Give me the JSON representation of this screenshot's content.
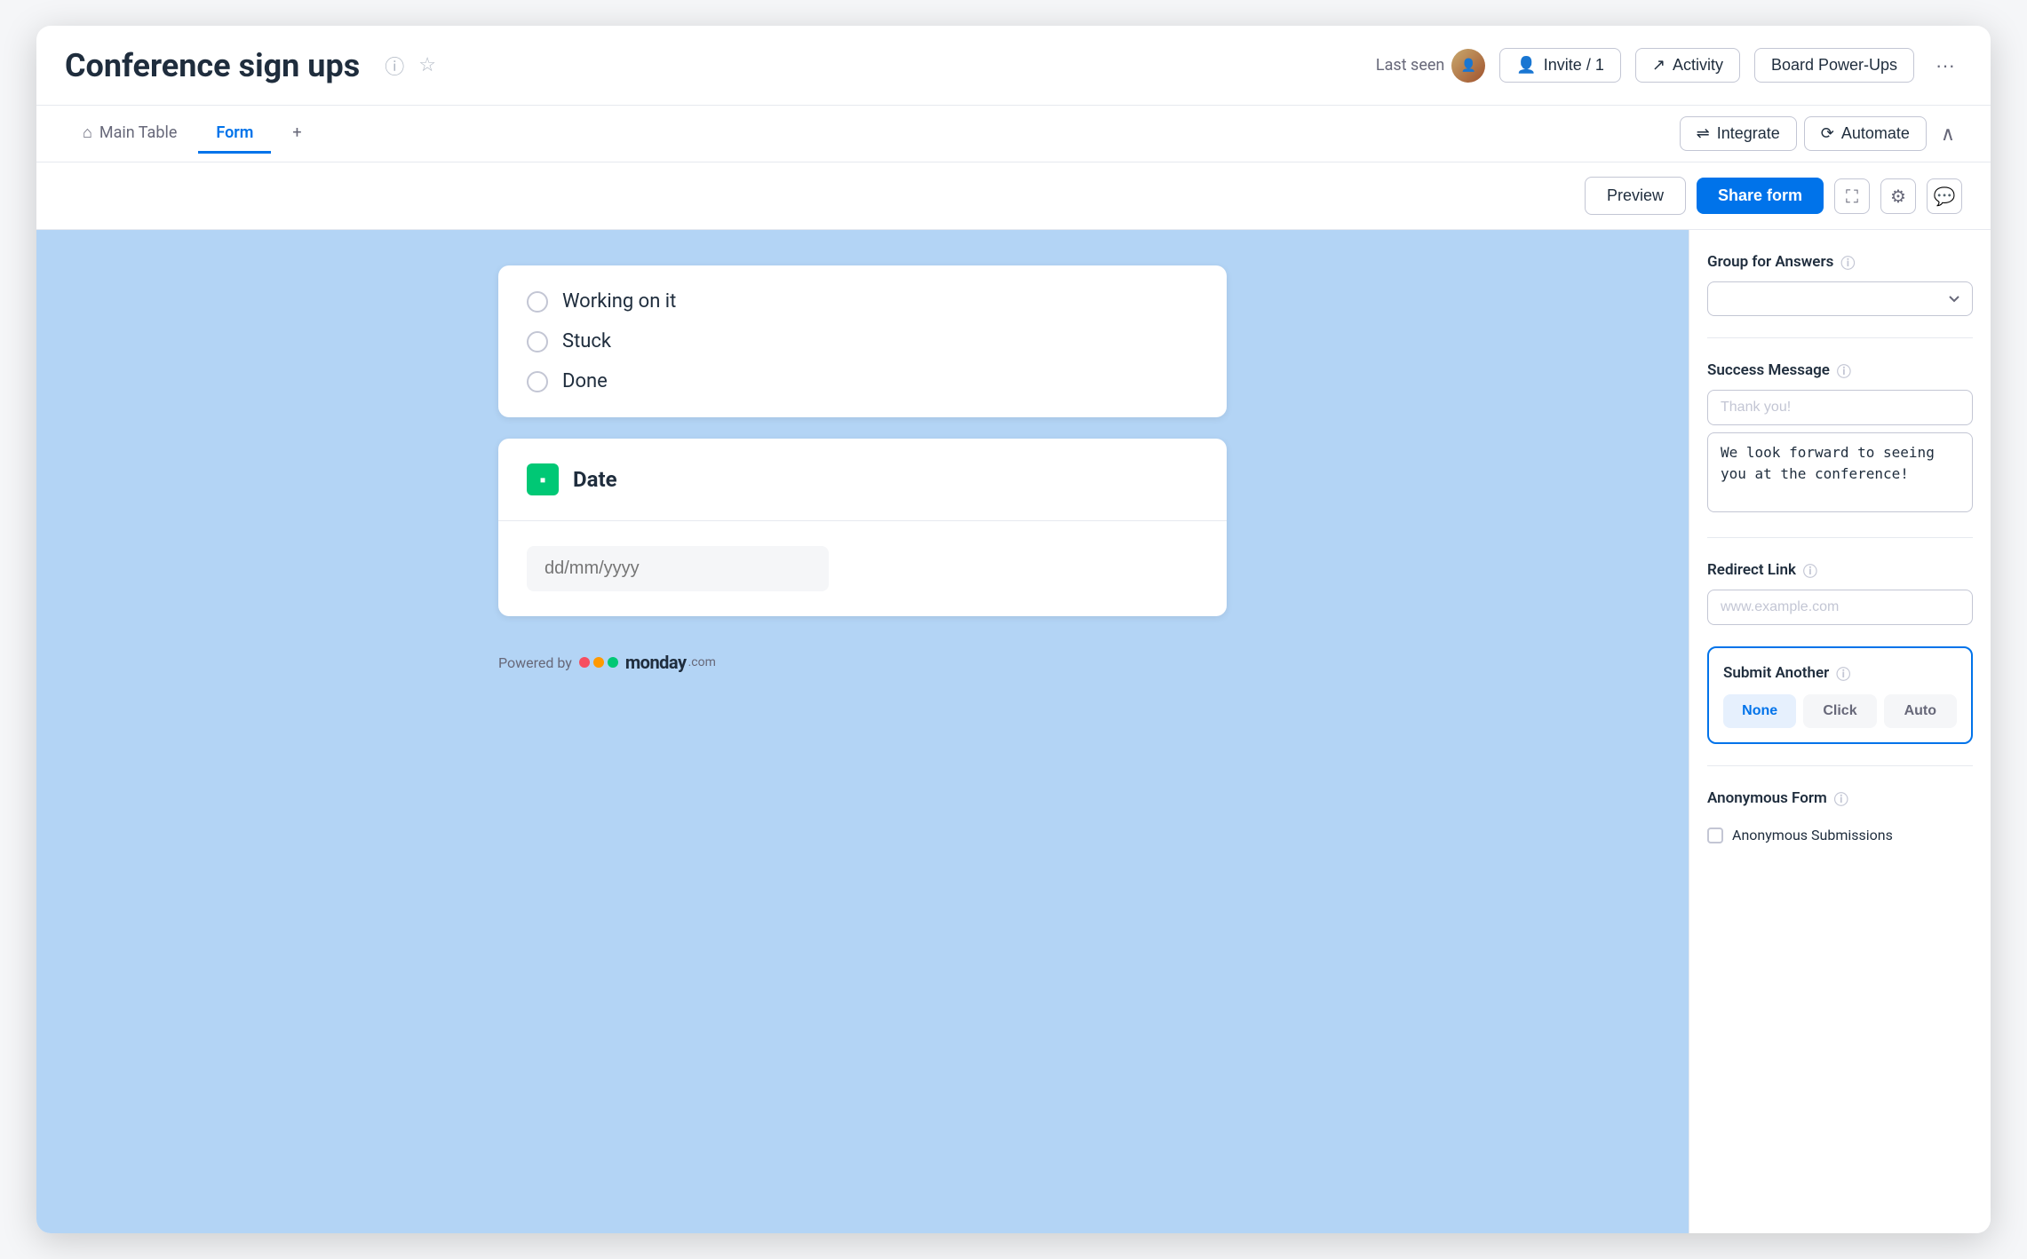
{
  "header": {
    "title": "Conference sign ups",
    "last_seen_label": "Last seen",
    "invite_label": "Invite / 1",
    "activity_label": "Activity",
    "board_powerups_label": "Board Power-Ups"
  },
  "tabs": {
    "main_table": "Main Table",
    "form": "Form",
    "add": "+"
  },
  "tab_actions": {
    "integrate": "Integrate",
    "automate": "Automate"
  },
  "toolbar": {
    "preview_label": "Preview",
    "share_label": "Share form"
  },
  "form": {
    "radio_options": [
      {
        "label": "Working on it"
      },
      {
        "label": "Stuck"
      },
      {
        "label": "Done"
      }
    ],
    "date_field": {
      "title": "Date",
      "placeholder": "dd/mm/yyyy"
    },
    "powered_by": "Powered by",
    "monday_logo": "monday",
    "monday_com": ".com"
  },
  "side_panel": {
    "group_for_answers_label": "Group for Answers",
    "group_placeholder": "",
    "success_message_label": "Success Message",
    "success_title_placeholder": "Thank you!",
    "success_body_value": "We look forward to seeing you at the conference!",
    "redirect_link_label": "Redirect Link",
    "redirect_placeholder": "www.example.com",
    "submit_another_label": "Submit Another",
    "submit_options": [
      {
        "label": "None",
        "active": true
      },
      {
        "label": "Click",
        "active": false
      },
      {
        "label": "Auto",
        "active": false
      }
    ],
    "anonymous_form_label": "Anonymous Form",
    "anonymous_submissions_label": "Anonymous Submissions"
  },
  "icons": {
    "info": "ℹ",
    "star": "☆",
    "chevron_down": "▾",
    "chevron_up": "∧",
    "more": "···",
    "home": "⌂",
    "integrate": "⇌",
    "automate": "⟳",
    "fullscreen": "⛶",
    "gear": "⚙",
    "chat": "💬",
    "activity": "↗",
    "calendar": "▪",
    "person": "👤"
  }
}
